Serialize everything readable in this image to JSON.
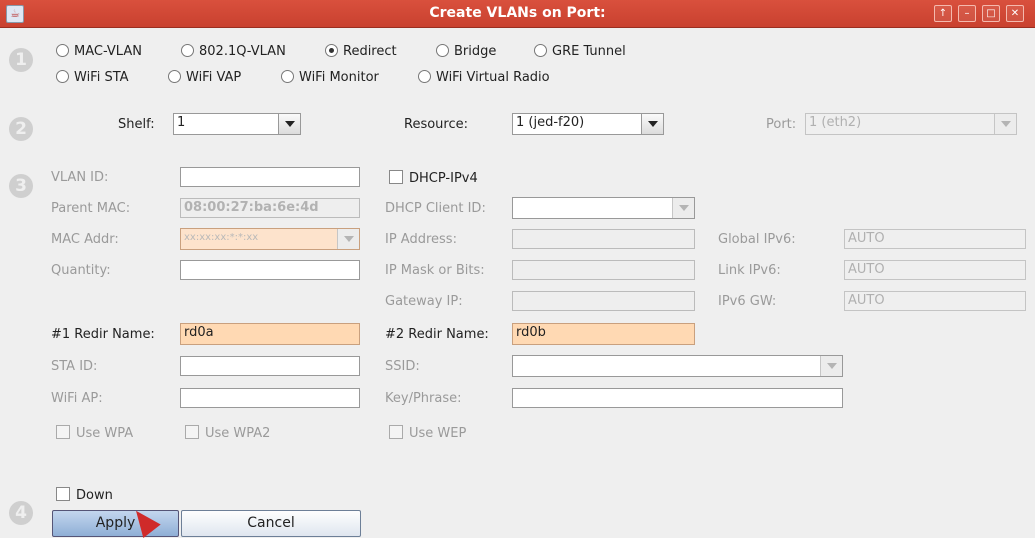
{
  "window": {
    "title": "Create VLANs on Port:",
    "controls": [
      "↑",
      "–",
      "□",
      "✕"
    ]
  },
  "steps": [
    "1",
    "2",
    "3",
    "4"
  ],
  "types": [
    {
      "label": "MAC-VLAN",
      "selected": false
    },
    {
      "label": "802.1Q-VLAN",
      "selected": false
    },
    {
      "label": "Redirect",
      "selected": true
    },
    {
      "label": "Bridge",
      "selected": false
    },
    {
      "label": "GRE Tunnel",
      "selected": false
    },
    {
      "label": "WiFi STA",
      "selected": false
    },
    {
      "label": "WiFi VAP",
      "selected": false
    },
    {
      "label": "WiFi Monitor",
      "selected": false
    },
    {
      "label": "WiFi Virtual Radio",
      "selected": false
    }
  ],
  "location": {
    "shelf_label": "Shelf:",
    "shelf_value": "1",
    "resource_label": "Resource:",
    "resource_value": "1 (jed-f20)",
    "port_label": "Port:",
    "port_value": "1 (eth2)"
  },
  "form": {
    "vlan_id_label": "VLAN ID:",
    "vlan_id_value": "",
    "dhcp_ipv4_label": "DHCP-IPv4",
    "parent_mac_label": "Parent MAC:",
    "parent_mac_value": "08:00:27:ba:6e:4d",
    "dhcp_client_id_label": "DHCP Client ID:",
    "dhcp_client_id_value": "",
    "mac_addr_label": "MAC Addr:",
    "mac_addr_value": "xx:xx:xx:*:*:xx",
    "ip_address_label": "IP Address:",
    "ip_address_value": "",
    "global_ipv6_label": "Global IPv6:",
    "global_ipv6_value": "AUTO",
    "quantity_label": "Quantity:",
    "quantity_value": "",
    "ip_mask_label": "IP Mask or Bits:",
    "ip_mask_value": "",
    "link_ipv6_label": "Link IPv6:",
    "link_ipv6_value": "AUTO",
    "gateway_ip_label": "Gateway IP:",
    "gateway_ip_value": "",
    "ipv6_gw_label": "IPv6 GW:",
    "ipv6_gw_value": "AUTO",
    "redir1_label": "#1 Redir Name:",
    "redir1_value": "rd0a",
    "redir2_label": "#2 Redir Name:",
    "redir2_value": "rd0b",
    "sta_id_label": "STA ID:",
    "sta_id_value": "",
    "ssid_label": "SSID:",
    "ssid_value": "",
    "wifi_ap_label": "WiFi AP:",
    "wifi_ap_value": "",
    "key_label": "Key/Phrase:",
    "key_value": "",
    "use_wpa_label": "Use WPA",
    "use_wpa2_label": "Use WPA2",
    "use_wep_label": "Use WEP"
  },
  "footer": {
    "down_label": "Down",
    "apply_label": "Apply",
    "cancel_label": "Cancel"
  }
}
